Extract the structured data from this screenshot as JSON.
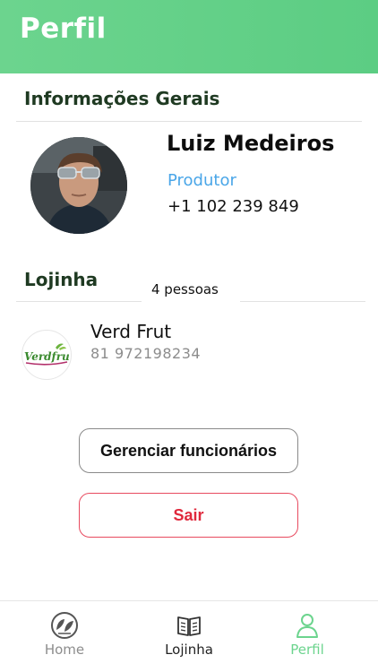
{
  "header": {
    "title": "Perfil"
  },
  "general_info": {
    "section_title": "Informações Gerais",
    "user": {
      "name": "Luiz Medeiros",
      "role": "Produtor",
      "phone": "+1 102 239 849"
    }
  },
  "store_section": {
    "section_title": "Lojinha",
    "people_count": "4 pessoas",
    "store": {
      "name": "Verd Frut",
      "phone": "81 972198234",
      "logo_text": "Verdfrut"
    }
  },
  "actions": {
    "manage_label": "Gerenciar funcionários",
    "logout_label": "Sair"
  },
  "tabbar": {
    "items": [
      {
        "label": "Home",
        "icon": "leaf-icon"
      },
      {
        "label": "Lojinha",
        "icon": "book-icon"
      },
      {
        "label": "Perfil",
        "icon": "person-icon",
        "active": true
      }
    ]
  },
  "colors": {
    "header": "#6cd48e",
    "accent_blue": "#4aa6e8",
    "danger": "#e0283c",
    "active_tab": "#6cd48e"
  }
}
